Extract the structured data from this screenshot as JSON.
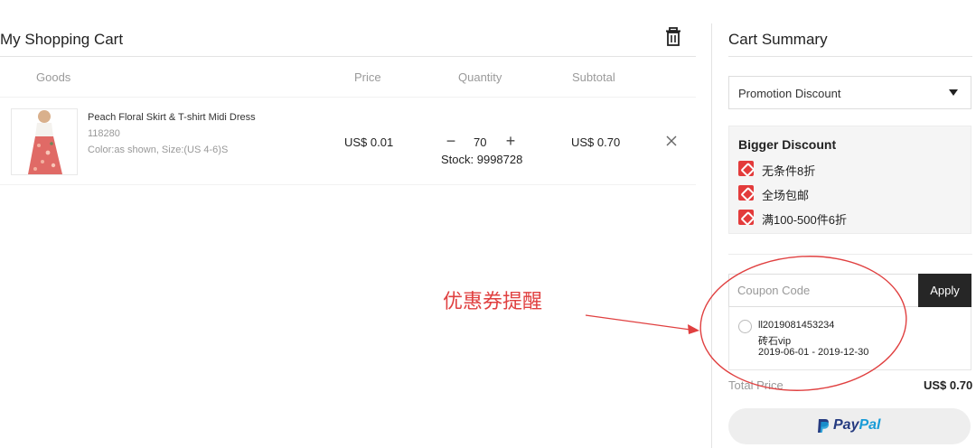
{
  "cart": {
    "title": "My Shopping Cart",
    "columns": {
      "goods": "Goods",
      "price": "Price",
      "quantity": "Quantity",
      "subtotal": "Subtotal"
    },
    "item": {
      "name": "Peach Floral Skirt & T-shirt Midi Dress",
      "sku": "118280",
      "attrs": "Color:as shown, Size:(US 4-6)S",
      "price": "US$ 0.01",
      "quantity": "70",
      "stock": "Stock: 9998728",
      "subtotal": "US$ 0.70"
    }
  },
  "summary": {
    "title": "Cart Summary",
    "promotion_select": "Promotion Discount",
    "discount_title": "Bigger Discount",
    "discounts": [
      "无条件8折",
      "全场包邮",
      "满100-500件6折"
    ],
    "coupon_placeholder": "Coupon Code",
    "apply_label": "Apply",
    "coupon": {
      "code": "ll2019081453234",
      "name": "砖石vip",
      "validity": "2019-06-01 - 2019-12-30"
    },
    "total_label": "Total Price",
    "total_value": "US$ 0.70",
    "paypal_part1": "Pay",
    "paypal_part2": "Pal"
  },
  "annotation": {
    "text": "优惠券提醒",
    "color": "#e04040"
  },
  "colors": {
    "accent_dark": "#262626",
    "discount_tag": "#e33b3b",
    "paypal_dark": "#253b80",
    "paypal_light": "#179bd7"
  },
  "icons": [
    "trash-icon",
    "close-icon",
    "minus-icon",
    "plus-icon",
    "caret-down-icon",
    "discount-tag-icon",
    "paypal-logo-icon"
  ]
}
